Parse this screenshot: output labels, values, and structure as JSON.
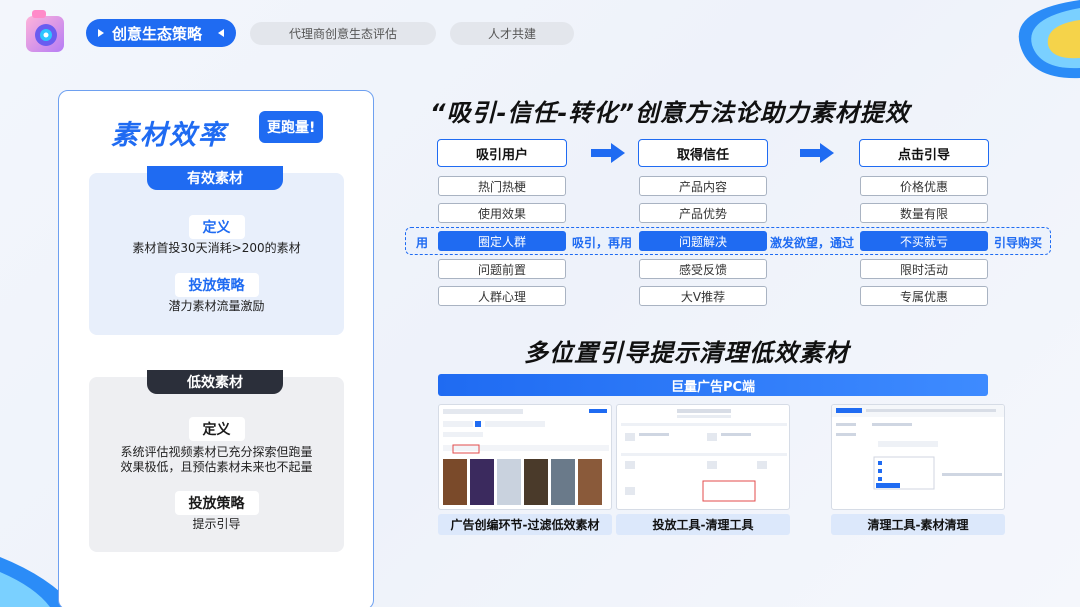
{
  "nav": {
    "active": "创意生态策略",
    "tab2": "代理商创意生态评估",
    "tab3": "人才共建"
  },
  "left": {
    "title": "素材效率",
    "tag": "更跑量!",
    "effective": {
      "header": "有效素材",
      "def_label": "定义",
      "def_text": "素材首投30天消耗>200的素材",
      "strategy_label": "投放策略",
      "strategy_text": "潜力素材流量激励"
    },
    "low": {
      "header": "低效素材",
      "def_label": "定义",
      "def_text_1": "系统评估视频素材已充分探索但跑量",
      "def_text_2": "效果极低，且预估素材未来也不起量",
      "strategy_label": "投放策略",
      "strategy_text": "提示引导"
    }
  },
  "right": {
    "heading": "“吸引-信任-转化”创意方法论助力素材提效",
    "columns": [
      {
        "head": "吸引用户",
        "cells": [
          "热门热梗",
          "使用效果",
          "圈定人群",
          "问题前置",
          "人群心理"
        ]
      },
      {
        "head": "取得信任",
        "cells": [
          "产品内容",
          "产品优势",
          "问题解决",
          "感受反馈",
          "大V推荐"
        ]
      },
      {
        "head": "点击引导",
        "cells": [
          "价格优惠",
          "数量有限",
          "不买就亏",
          "限时活动",
          "专属优惠"
        ]
      }
    ],
    "band": {
      "t1": "用",
      "t2": "吸引，再用",
      "t3": "激发欲望，通过",
      "t4": "引导购买"
    },
    "sub_heading": "多位置引导提示清理低效素材",
    "pc_bar": "巨量广告PC端",
    "captions": [
      "广告创编环节-过滤低效素材",
      "投放工具-清理工具",
      "清理工具-素材清理"
    ]
  },
  "colors": {
    "accent": "#1f6bf2",
    "dark": "#2b2f3a"
  }
}
